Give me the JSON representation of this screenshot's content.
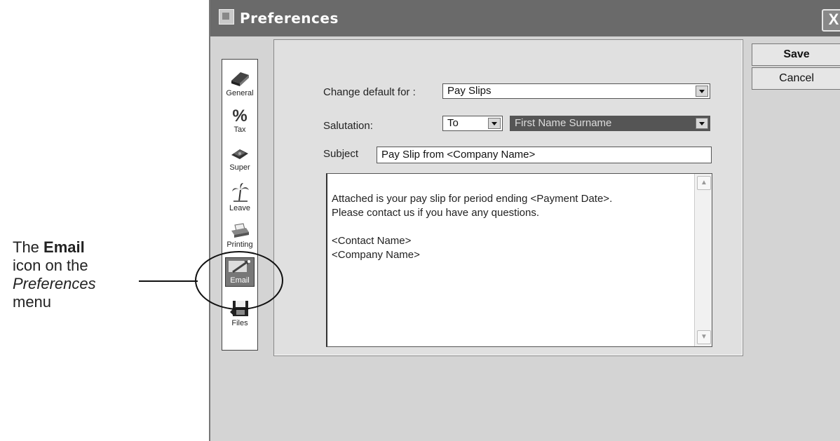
{
  "annotation": {
    "line1_pre": "The ",
    "line1_bold": "Email",
    "line2": "icon on the",
    "line3_italic": "Preferences",
    "line4": "menu"
  },
  "window": {
    "title": "Preferences",
    "close_glyph": "X"
  },
  "sidebar": {
    "items": [
      {
        "label": "General",
        "icon": "book-icon"
      },
      {
        "label": "Tax",
        "icon": "percent-icon"
      },
      {
        "label": "Super",
        "icon": "money-icon"
      },
      {
        "label": "Leave",
        "icon": "palm-tree-icon"
      },
      {
        "label": "Printing",
        "icon": "printer-icon"
      },
      {
        "label": "Email",
        "icon": "email-icon"
      },
      {
        "label": "Files",
        "icon": "floppy-disk-icon"
      }
    ],
    "percent_glyph": "%"
  },
  "form": {
    "change_default_label": "Change default for :",
    "change_default_value": "Pay Slips",
    "salutation_label": "Salutation:",
    "salutation_value": "To",
    "name_format_value": "First Name Surname",
    "subject_label": "Subject",
    "subject_value": "Pay Slip from <Company Name>",
    "body_lines": [
      "Attached is your pay slip for period ending <Payment Date>.",
      "Please contact us if you have any questions.",
      "",
      "<Contact Name>",
      "<Company Name>"
    ]
  },
  "buttons": {
    "save_label": "Save",
    "cancel_label": "Cancel"
  },
  "colors": {
    "titlebar": "#6a6a6a",
    "window_bg": "#d4d4d4"
  }
}
